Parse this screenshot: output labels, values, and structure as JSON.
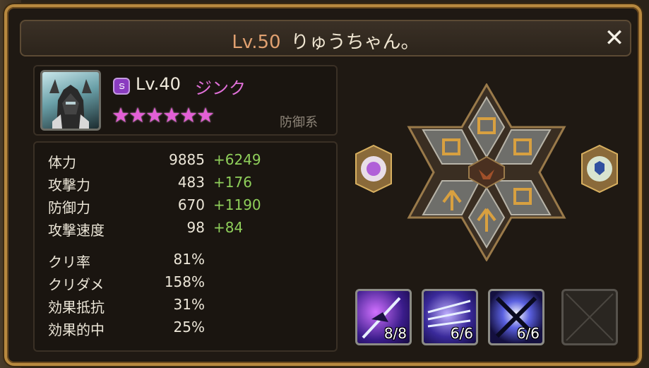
{
  "header": {
    "level": "Lv.50",
    "name": "りゅうちゃん。",
    "close_label": "✕"
  },
  "monster": {
    "element_icon": "dark-element-icon",
    "level": "Lv.40",
    "name": "ジンク",
    "stars": "★★★★★★",
    "star_count": 6,
    "type": "防御系"
  },
  "stats": [
    {
      "label": "体力",
      "base": "9885",
      "bonus": "+6249"
    },
    {
      "label": "攻撃力",
      "base": "483",
      "bonus": "+176"
    },
    {
      "label": "防御力",
      "base": "670",
      "bonus": "+1190"
    },
    {
      "label": "攻撃速度",
      "base": "98",
      "bonus": "+84"
    },
    {
      "label": "クリ率",
      "base": "81%",
      "bonus": ""
    },
    {
      "label": "クリダメ",
      "base": "158%",
      "bonus": ""
    },
    {
      "label": "効果抵抗",
      "base": "31%",
      "bonus": ""
    },
    {
      "label": "効果的中",
      "base": "25%",
      "bonus": ""
    }
  ],
  "skills": [
    {
      "level": "8/8"
    },
    {
      "level": "6/6"
    },
    {
      "level": "6/6"
    }
  ],
  "colors": {
    "frame": "#b8893f",
    "bonus_green": "#8fcf5a",
    "name_pink": "#e070d8",
    "star_pink": "#e35fd6",
    "level_orange": "#e0a070"
  }
}
